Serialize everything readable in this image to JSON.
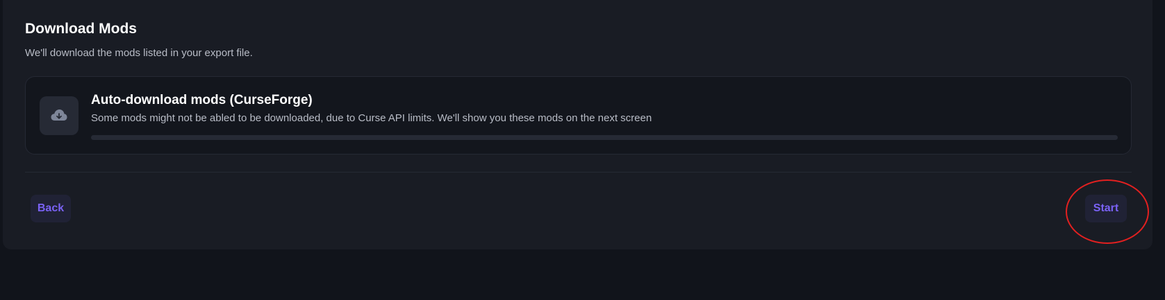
{
  "section": {
    "title": "Download Mods",
    "subtitle": "We'll download the mods listed in your export file."
  },
  "task_card": {
    "icon": "cloud-download-icon",
    "title": "Auto-download mods (CurseForge)",
    "description": "Some mods might not be abled to be downloaded, due to Curse API limits. We'll show you these mods on the next screen",
    "progress_fraction": 0
  },
  "footer": {
    "back_label": "Back",
    "start_label": "Start"
  },
  "colors": {
    "page_background": "#11141b",
    "panel_background": "#191c24",
    "card_background": "#13161d",
    "accent": "#7a62f5",
    "annotation_ring": "#e22020"
  }
}
